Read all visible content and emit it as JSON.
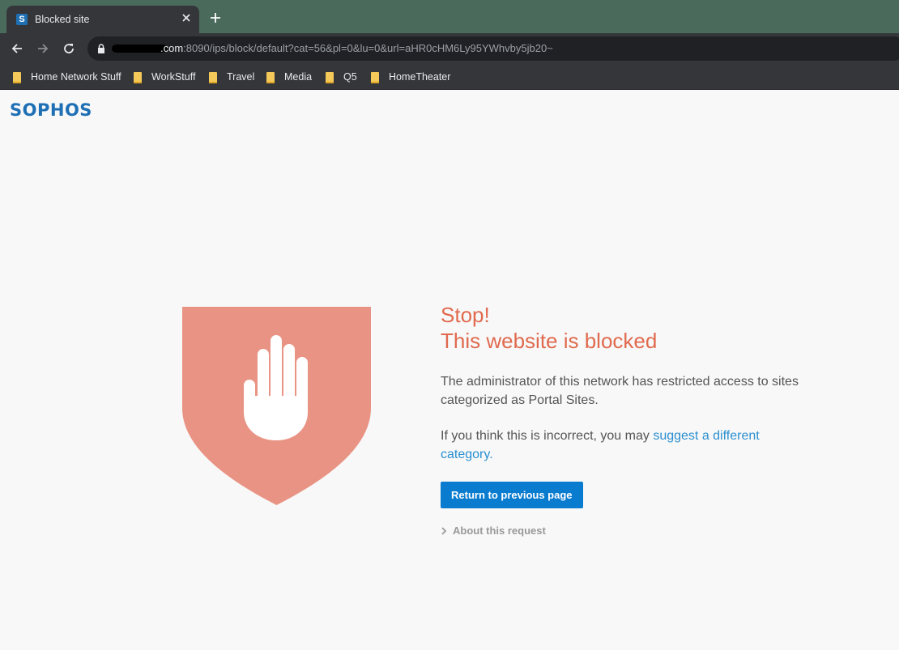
{
  "browser": {
    "tab_title": "Blocked site",
    "favicon_letter": "S",
    "url_host_suffix": ".com",
    "url_rest": ":8090/ips/block/default?cat=56&pl=0&lu=0&url=aHR0cHM6Ly95YWhvby5jb20~",
    "bookmarks": [
      {
        "label": "Home Network Stuff"
      },
      {
        "label": "WorkStuff"
      },
      {
        "label": "Travel"
      },
      {
        "label": "Media"
      },
      {
        "label": "Q5"
      },
      {
        "label": "HomeTheater"
      }
    ]
  },
  "page": {
    "logo": "SOPHOS",
    "stop": "Stop!",
    "headline": "This website is blocked",
    "message": "The administrator of this network has restricted access to sites categorized as Portal Sites.",
    "incorrect_prefix": "If you think this is incorrect, you may ",
    "suggest_link": "suggest a different category",
    "incorrect_suffix": ".",
    "return_button": "Return to previous page",
    "about_request": "About this request"
  },
  "colors": {
    "accent_red": "#e06a4e",
    "shield": "#e99384",
    "button_blue": "#0a7ccf",
    "link_blue": "#2a8fd0",
    "logo_blue": "#1f6fb5"
  }
}
